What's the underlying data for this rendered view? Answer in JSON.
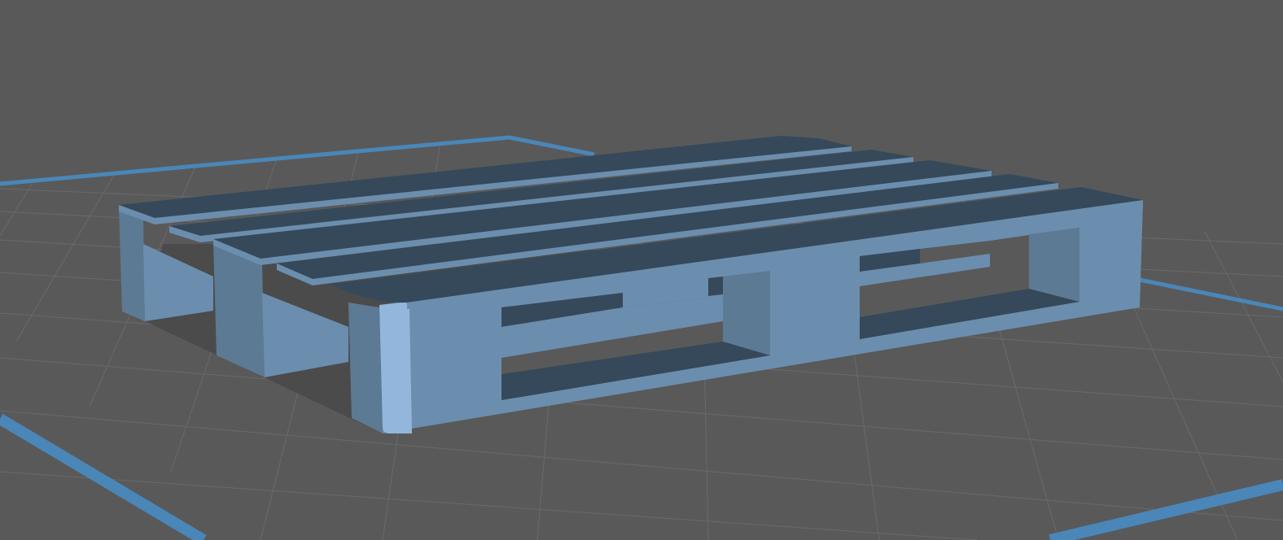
{
  "app": {
    "view": "3d-viewport",
    "model": "pallet"
  },
  "colors": {
    "background": "#595959",
    "grid_line": "#6a6a6a",
    "build_plate_border": "#4a86b8",
    "model_top": "#35495a",
    "model_front": "#6b8eaf",
    "model_side": "#5c7a94",
    "model_highlight": "#93b7dc",
    "model_underside": "#2f3f4f",
    "shadow": "#4b4b4b"
  },
  "icons": {
    "model": "pallet-model-icon"
  }
}
